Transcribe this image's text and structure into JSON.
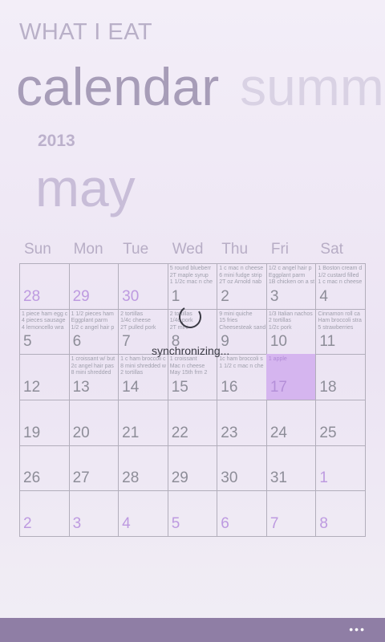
{
  "app": {
    "title": "WHAT I EAT"
  },
  "pivot": {
    "active": "calendar",
    "inactive": "summ"
  },
  "header": {
    "year": "2013",
    "month": "may"
  },
  "weekdays": [
    "Sun",
    "Mon",
    "Tue",
    "Wed",
    "Thu",
    "Fri",
    "Sat"
  ],
  "weeks": [
    [
      {
        "day": "28",
        "other": true,
        "notes": []
      },
      {
        "day": "29",
        "other": true,
        "notes": []
      },
      {
        "day": "30",
        "other": true,
        "notes": []
      },
      {
        "day": "1",
        "notes": [
          "5 round blueberr",
          "2T maple syrup",
          "1 1/2c mac n che"
        ]
      },
      {
        "day": "2",
        "notes": [
          "1 c mac n cheese",
          "6 mini fudge strip",
          "2T oz Arnold nab"
        ]
      },
      {
        "day": "3",
        "notes": [
          "1/2 c angel hair p",
          "Eggplant parm",
          "1B chicken on a st"
        ]
      },
      {
        "day": "4",
        "notes": [
          "1 Boston cream d",
          "1/2 custard filled",
          "1 c mac n cheese"
        ]
      }
    ],
    [
      {
        "day": "5",
        "notes": [
          "1 piece ham egg c",
          "4 pieces sausage",
          "4 lemoncello wra"
        ]
      },
      {
        "day": "6",
        "notes": [
          "1 1/2 pieces ham",
          "Eggplant parm",
          "1/2 c angel hair p"
        ]
      },
      {
        "day": "7",
        "notes": [
          "2 tortillas",
          "1/4c cheese",
          "2T pulled pork"
        ]
      },
      {
        "day": "8",
        "notes": [
          "2 tortillas",
          "1/4c pork",
          "2T mini"
        ]
      },
      {
        "day": "9",
        "notes": [
          "9 mini quiche",
          "15 fries",
          "Cheesesteak sand"
        ]
      },
      {
        "day": "10",
        "notes": [
          "1/3 Italian nachos",
          "2 tortillas",
          "1/2c pork"
        ]
      },
      {
        "day": "11",
        "notes": [
          "Cinnamon roll ca",
          "Ham broccoli stra",
          "5 strawberries"
        ]
      }
    ],
    [
      {
        "day": "12",
        "notes": []
      },
      {
        "day": "13",
        "notes": [
          "1 croissant w/ but",
          "2c angel hair pas",
          "8 mini shredded"
        ]
      },
      {
        "day": "14",
        "notes": [
          "1 c ham broccoli c",
          "8 mini shredded w",
          "2 tortillas"
        ]
      },
      {
        "day": "15",
        "notes": [
          "1 croissant",
          "Mac n cheese",
          "May 15th frm 2"
        ]
      },
      {
        "day": "16",
        "notes": [
          "1c ham broccoli s",
          "1 1/2 c mac n che",
          ""
        ]
      },
      {
        "day": "17",
        "today": true,
        "notes": [
          "1 apple"
        ]
      },
      {
        "day": "18",
        "notes": []
      }
    ],
    [
      {
        "day": "19",
        "notes": []
      },
      {
        "day": "20",
        "notes": []
      },
      {
        "day": "21",
        "notes": []
      },
      {
        "day": "22",
        "notes": []
      },
      {
        "day": "23",
        "notes": []
      },
      {
        "day": "24",
        "notes": []
      },
      {
        "day": "25",
        "notes": []
      }
    ],
    [
      {
        "day": "26",
        "notes": []
      },
      {
        "day": "27",
        "notes": []
      },
      {
        "day": "28",
        "notes": []
      },
      {
        "day": "29",
        "notes": []
      },
      {
        "day": "30",
        "notes": []
      },
      {
        "day": "31",
        "notes": []
      },
      {
        "day": "1",
        "other": true,
        "notes": []
      }
    ],
    [
      {
        "day": "2",
        "other": true,
        "notes": []
      },
      {
        "day": "3",
        "other": true,
        "notes": []
      },
      {
        "day": "4",
        "other": true,
        "notes": []
      },
      {
        "day": "5",
        "other": true,
        "notes": []
      },
      {
        "day": "6",
        "other": true,
        "notes": []
      },
      {
        "day": "7",
        "other": true,
        "notes": []
      },
      {
        "day": "8",
        "other": true,
        "notes": []
      }
    ]
  ],
  "sync": {
    "label": "synchronizing..."
  },
  "appbar": {
    "more_label": "•••",
    "more_icon": "ellipsis-icon"
  },
  "colors": {
    "accent": "#d5b5ef",
    "appbar": "#8f7ea5"
  }
}
